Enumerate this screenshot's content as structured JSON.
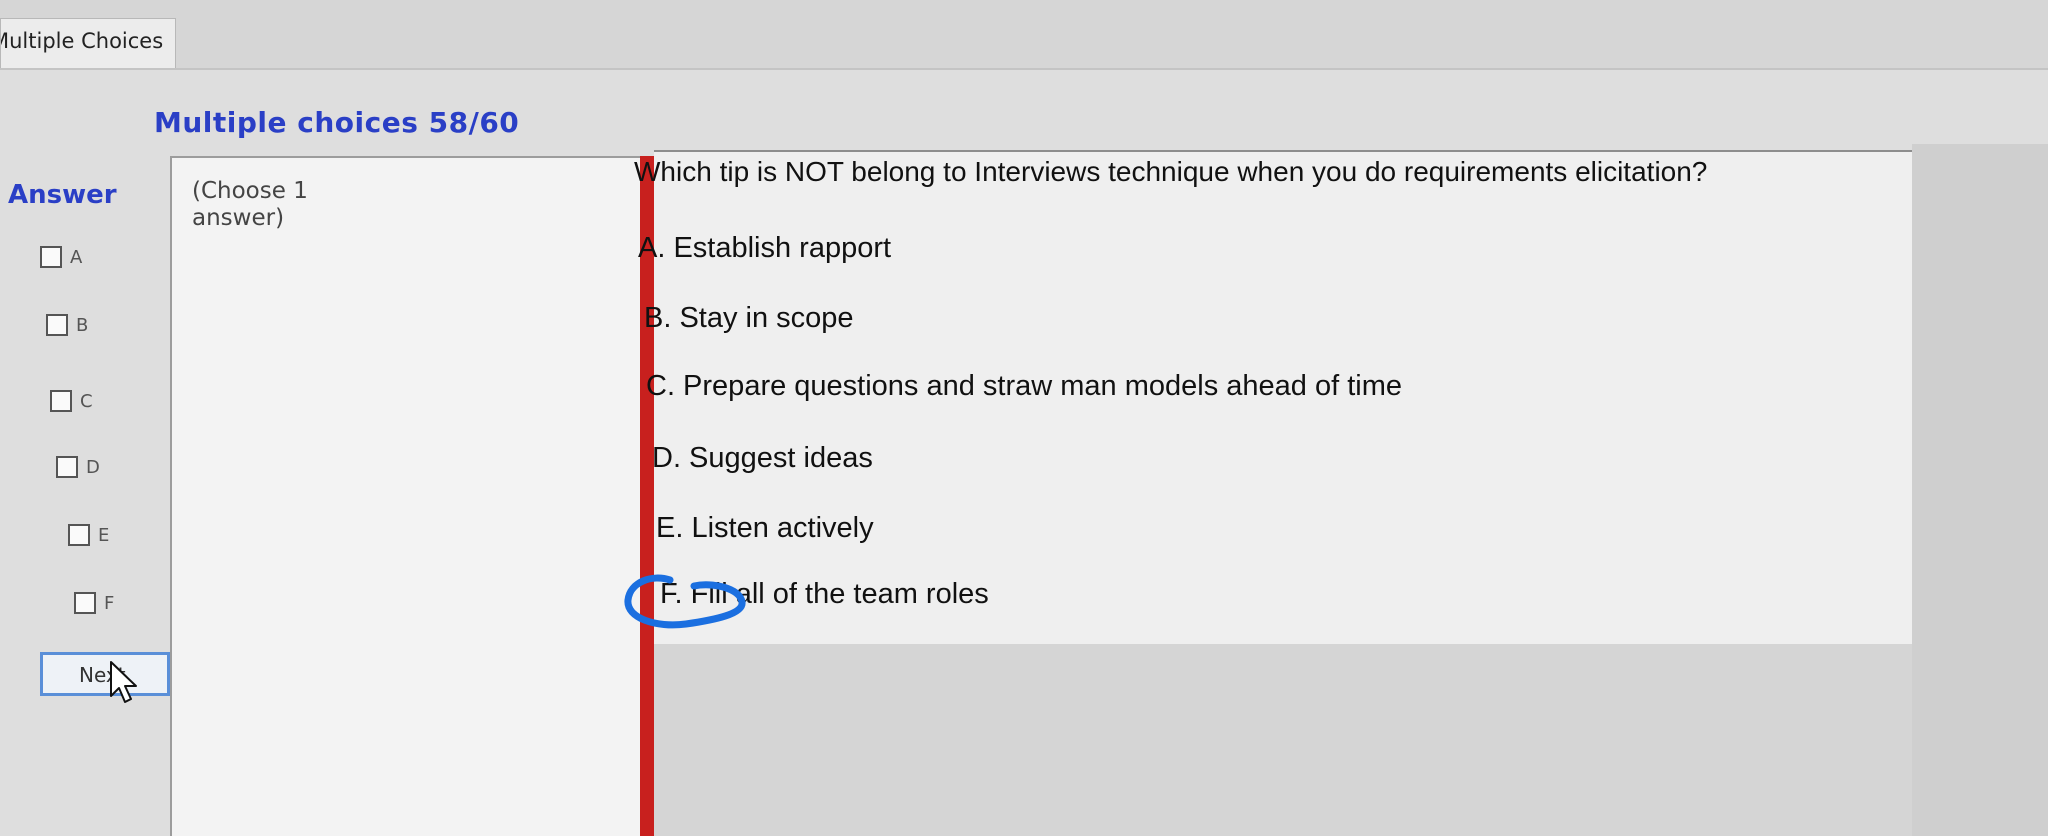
{
  "tab": {
    "label": "Multiple Choices"
  },
  "header": {
    "title": "Multiple choices 58/60"
  },
  "answer_panel": {
    "heading": "Answer",
    "options": [
      {
        "letter": "A"
      },
      {
        "letter": "B"
      },
      {
        "letter": "C"
      },
      {
        "letter": "D"
      },
      {
        "letter": "E"
      },
      {
        "letter": "F"
      }
    ],
    "next_button": "Next"
  },
  "instruction": {
    "text": "(Choose 1 answer)"
  },
  "question": {
    "text": "Which tip is NOT belong to Interviews technique when you do requirements elicitation?",
    "choices": [
      "A. Establish rapport",
      "B. Stay in scope",
      "C. Prepare questions and straw man models ahead of time",
      "D. Suggest ideas",
      "E. Listen actively",
      "F. Fill all of the team roles"
    ]
  },
  "colors": {
    "accent": "#2a3fc6",
    "divider": "#c8201e",
    "annotation": "#1b6fe0"
  }
}
